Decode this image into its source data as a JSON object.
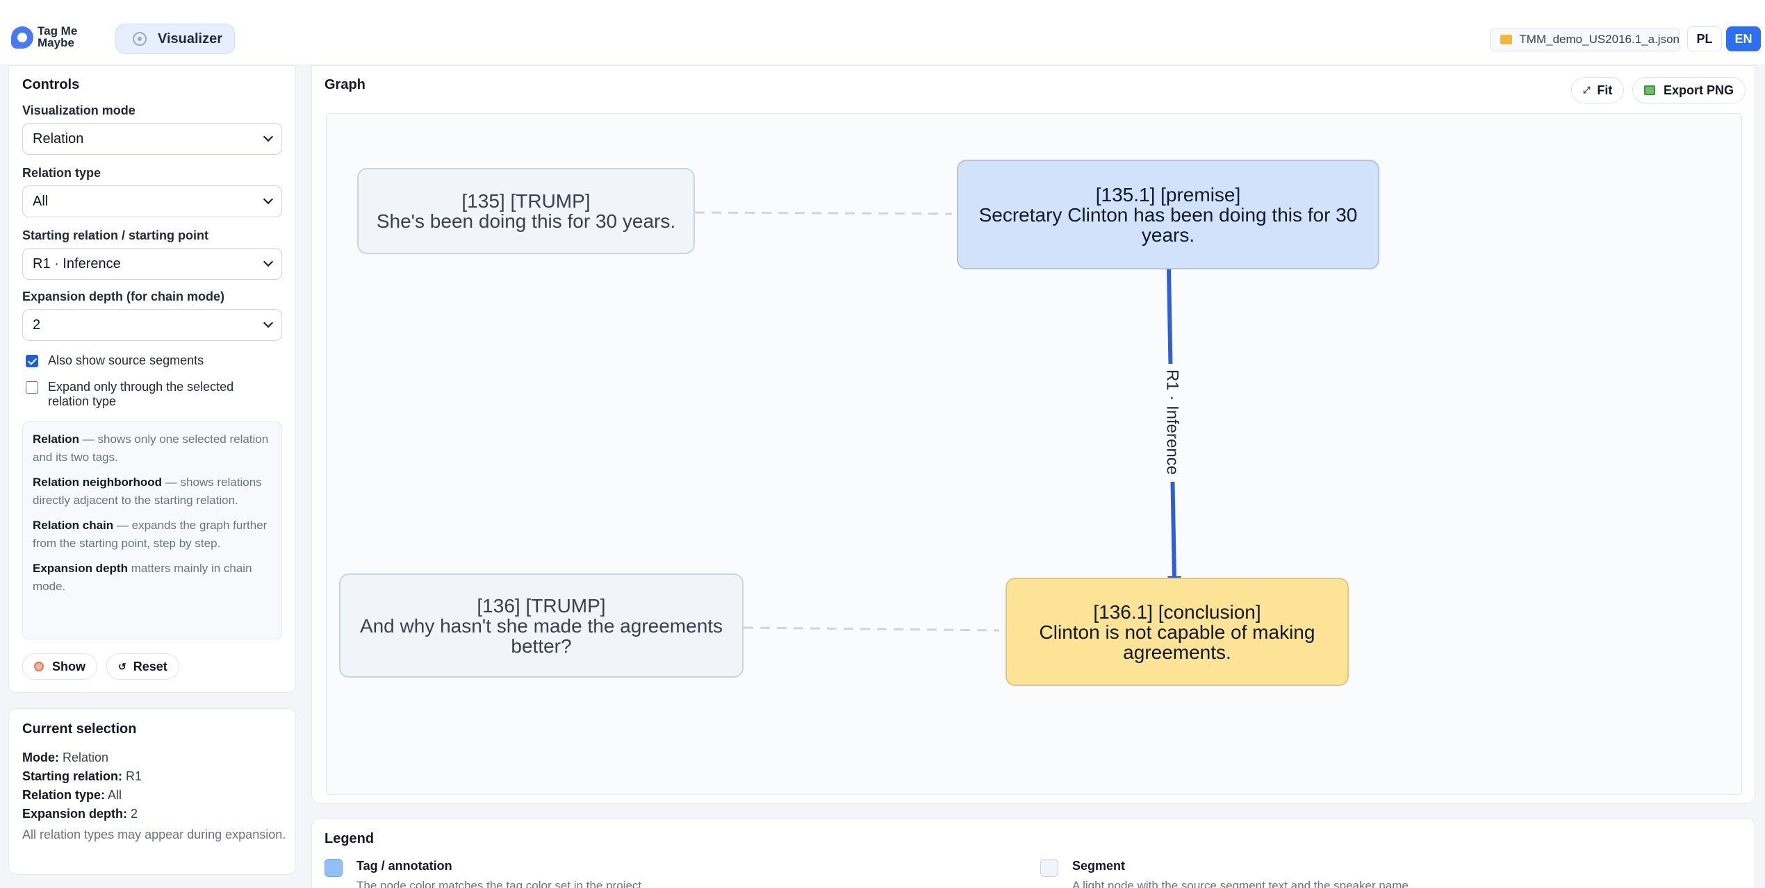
{
  "header": {
    "brand_line1": "Tag Me",
    "brand_line2": "Maybe",
    "nav_label": "Visualizer",
    "file_name": "TMM_demo_US2016.1_a.json",
    "lang_pl": "PL",
    "lang_en": "EN"
  },
  "controls": {
    "title": "Controls",
    "mode_label": "Visualization mode",
    "mode_value": "Relation",
    "rel_type_label": "Relation type",
    "rel_type_value": "All",
    "start_label": "Starting relation / starting point",
    "start_value": "R1 · Inference",
    "depth_label": "Expansion depth (for chain mode)",
    "depth_value": "2",
    "cb_source_label": "Also show source segments",
    "cb_source_checked": true,
    "cb_expand_label": "Expand only through the selected relation type",
    "cb_expand_checked": false,
    "help": [
      {
        "term": "Relation",
        "text": " — shows only one selected relation and its two tags."
      },
      {
        "term": "Relation neighborhood",
        "text": " — shows relations directly adjacent to the starting relation."
      },
      {
        "term": "Relation chain",
        "text": " — expands the graph further from the starting point, step by step."
      },
      {
        "term": "Expansion depth",
        "text": " matters mainly in chain mode."
      }
    ],
    "show_btn": "Show",
    "reset_btn": "Reset"
  },
  "selection": {
    "title": "Current selection",
    "mode_key": "Mode:",
    "mode_val": " Relation",
    "start_key": "Starting relation:",
    "start_val": " R1",
    "type_key": "Relation type:",
    "type_val": " All",
    "depth_key": "Expansion depth:",
    "depth_val": " 2",
    "note": "All relation types may appear during expansion."
  },
  "graph": {
    "title": "Graph",
    "fit_btn": "Fit",
    "export_btn": "Export PNG",
    "nodes": {
      "seg135_head": "[135] [TRUMP]",
      "seg135_text": "She's been doing this for 30 years.",
      "premise_head": "[135.1] [premise]",
      "premise_text": "Secretary Clinton has been doing this for 30 years.",
      "seg136_head": "[136] [TRUMP]",
      "seg136_text": "And why hasn't she made the agreements better?",
      "conclusion_head": "[136.1] [conclusion]",
      "conclusion_text": "Clinton is not capable of making agreements."
    },
    "edge_label": "R1 · Inference",
    "colors": {
      "premise": "#d3e2fb",
      "conclusion": "#fde396",
      "segment": "#f1f4f8",
      "edge": "#2e5fd6"
    }
  },
  "legend": {
    "title": "Legend",
    "tag_title": "Tag / annotation",
    "tag_desc": "The node color matches the tag color set in the project.",
    "seg_title": "Segment",
    "seg_desc": "A light node with the source segment text and the speaker name."
  }
}
